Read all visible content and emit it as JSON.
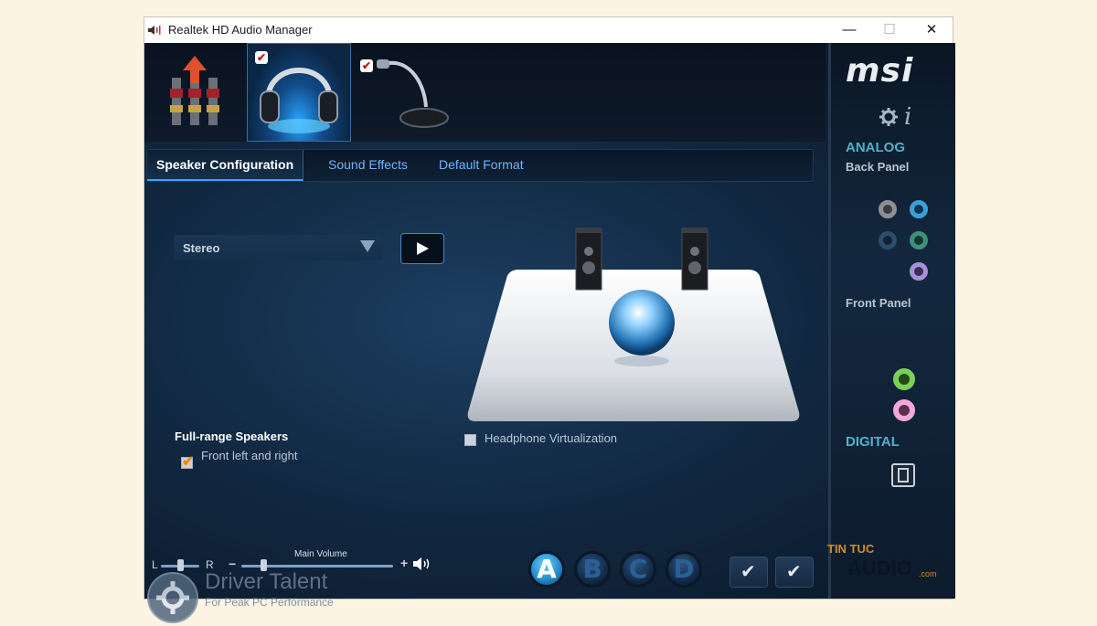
{
  "window": {
    "title": "Realtek HD Audio Manager",
    "controls": {
      "minimize": "—",
      "maximize": "☐",
      "close": "✕"
    }
  },
  "devices": [
    {
      "name": "speakers-device",
      "icon": "rca-plugs-icon",
      "selected": false,
      "checked": false
    },
    {
      "name": "headphones-device",
      "icon": "headphones-icon",
      "selected": true,
      "checked": true
    },
    {
      "name": "microphone-device",
      "icon": "microphone-icon",
      "selected": false,
      "checked": true
    }
  ],
  "tabs": {
    "speaker_configuration": "Speaker Configuration",
    "sound_effects": "Sound Effects",
    "default_format": "Default Format"
  },
  "speaker_config": {
    "selected": "Stereo",
    "full_range_heading": "Full-range Speakers",
    "front_lr_label": "Front left and right",
    "front_lr_checked": true,
    "headphone_virtualization_label": "Headphone Virtualization",
    "headphone_virtualization_checked": false
  },
  "volume": {
    "title": "Main Volume",
    "balance_left": "L",
    "balance_right": "R",
    "minus": "−",
    "plus": "+",
    "balance_value": 0.5,
    "volume_value": 0.15
  },
  "profiles": [
    {
      "label": "A",
      "active": true
    },
    {
      "label": "B",
      "active": false
    },
    {
      "label": "C",
      "active": false
    },
    {
      "label": "D",
      "active": false
    }
  ],
  "right_panel": {
    "brand": "msi",
    "analog": "ANALOG",
    "back_panel": "Back Panel",
    "front_panel": "Front Panel",
    "digital": "DIGITAL",
    "jack_colors": {
      "gray": "#8b8f96",
      "blue": "#3aa0d8",
      "dark": "#2b4e6a",
      "green_dim": "#3f8f7a",
      "purple": "#a890d8",
      "green": "#7ccf5a",
      "pink": "#f2a8d8"
    }
  },
  "watermarks": {
    "driver_talent": "Driver Talent",
    "driver_talent_sub": "For Peak PC Performance",
    "tintuc": "TIN TUC",
    "audio": "AUDIO",
    "dotcom": ".com"
  }
}
